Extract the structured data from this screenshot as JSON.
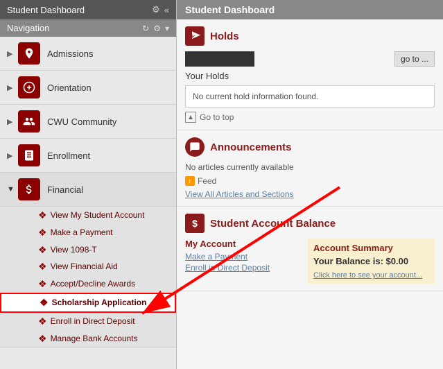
{
  "leftPanel": {
    "header": {
      "title": "Student Dashboard",
      "settingsIcon": "⚙",
      "closeIcon": "«"
    },
    "navigation": {
      "label": "Navigation",
      "refreshIcon": "↻",
      "settingsIcon": "⚙",
      "arrowIcon": "▾"
    },
    "navItems": [
      {
        "id": "admissions",
        "label": "Admissions",
        "icon": "admissions",
        "expanded": false
      },
      {
        "id": "orientation",
        "label": "Orientation",
        "icon": "orientation",
        "expanded": false
      },
      {
        "id": "cwu-community",
        "label": "CWU Community",
        "icon": "community",
        "expanded": false
      },
      {
        "id": "enrollment",
        "label": "Enrollment",
        "icon": "enrollment",
        "expanded": false
      },
      {
        "id": "financial",
        "label": "Financial",
        "icon": "financial",
        "expanded": true
      }
    ],
    "financialSubItems": [
      {
        "id": "view-my-student-account",
        "label": "View My Student Account",
        "highlighted": false
      },
      {
        "id": "make-a-payment",
        "label": "Make a Payment",
        "highlighted": false
      },
      {
        "id": "view-1098-t",
        "label": "View 1098-T",
        "highlighted": false
      },
      {
        "id": "view-financial-aid",
        "label": "View Financial Aid",
        "highlighted": false
      },
      {
        "id": "accept-decline-awards",
        "label": "Accept/Decline Awards",
        "highlighted": false
      },
      {
        "id": "scholarship-application",
        "label": "Scholarship Application",
        "highlighted": true
      },
      {
        "id": "enroll-in-direct-deposit",
        "label": "Enroll in Direct Deposit",
        "highlighted": false
      },
      {
        "id": "manage-bank-accounts",
        "label": "Manage Bank Accounts",
        "highlighted": false
      }
    ]
  },
  "rightPanel": {
    "header": "Student Dashboard",
    "holds": {
      "title": "Holds",
      "holdIdPlaceholder": "XXXXXXXXXX",
      "goToLabel": "go to ...",
      "yourHoldsLabel": "Your Holds",
      "noHoldsMessage": "No current hold information found.",
      "goToTopLabel": "Go to top"
    },
    "announcements": {
      "title": "Announcements",
      "noArticles": "No articles currently available",
      "feedLabel": "Feed",
      "viewAllLabel": "View All Articles and Sections"
    },
    "studentAccountBalance": {
      "title": "Student Account Balance",
      "myAccount": {
        "title": "My Account",
        "links": [
          "Make a Payment",
          "Enroll in Direct Deposit"
        ]
      },
      "accountSummary": {
        "title": "Account Summary",
        "balance": "Your Balance is: $0.00",
        "clickHere": "Click here to see your account..."
      }
    }
  }
}
